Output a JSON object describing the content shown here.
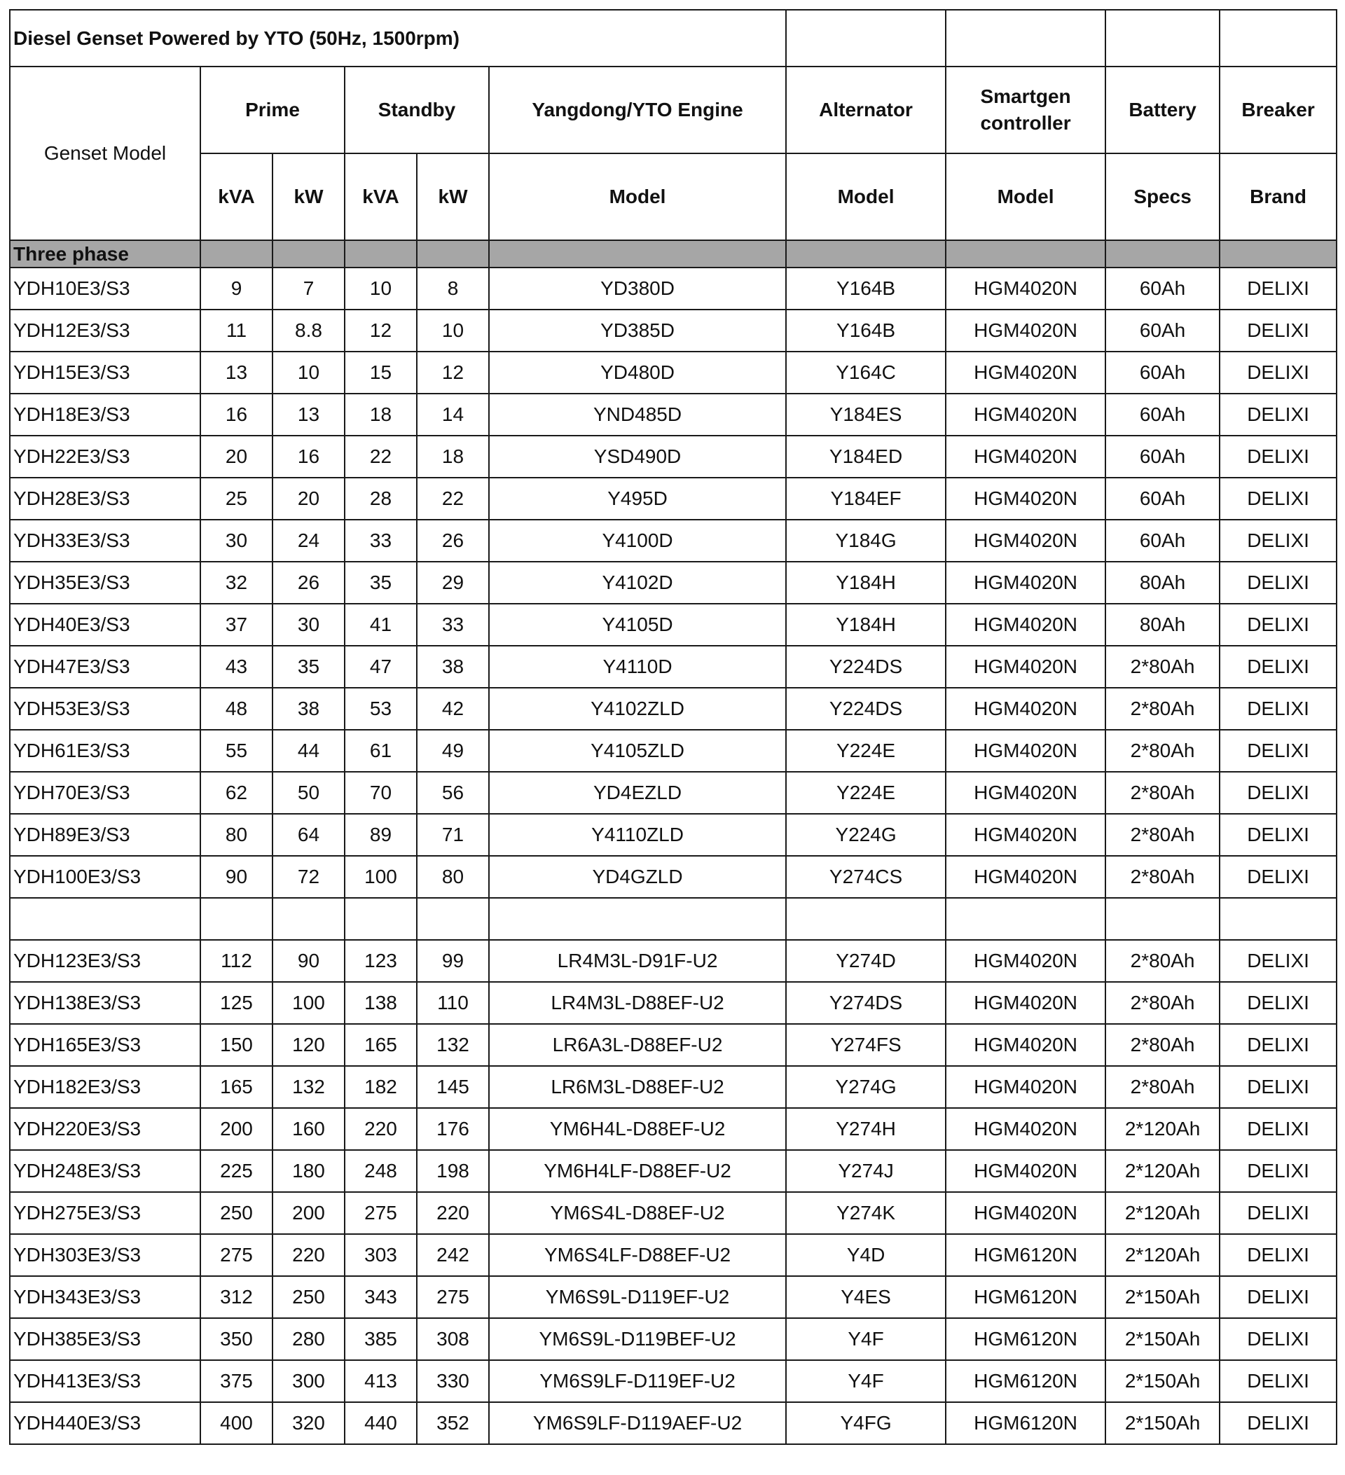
{
  "title": "Diesel Genset Powered by YTO (50Hz, 1500rpm)",
  "headers": {
    "genset_model": "Genset Model",
    "prime": "Prime",
    "standby": "Standby",
    "engine": "Yangdong/YTO Engine",
    "alternator": "Alternator",
    "controller": "Smartgen controller",
    "battery": "Battery",
    "breaker": "Breaker",
    "kva1": "kVA",
    "kw1": "kW",
    "kva2": "kVA",
    "kw2": "kW",
    "engine_sub": "Model",
    "alternator_sub": "Model",
    "controller_sub": "Model",
    "battery_sub": "Specs",
    "breaker_sub": "Brand"
  },
  "section_label": "Three phase",
  "rows_a": [
    [
      "YDH10E3/S3",
      "9",
      "7",
      "10",
      "8",
      "YD380D",
      "Y164B",
      "HGM4020N",
      "60Ah",
      "DELIXI"
    ],
    [
      "YDH12E3/S3",
      "11",
      "8.8",
      "12",
      "10",
      "YD385D",
      "Y164B",
      "HGM4020N",
      "60Ah",
      "DELIXI"
    ],
    [
      "YDH15E3/S3",
      "13",
      "10",
      "15",
      "12",
      "YD480D",
      "Y164C",
      "HGM4020N",
      "60Ah",
      "DELIXI"
    ],
    [
      "YDH18E3/S3",
      "16",
      "13",
      "18",
      "14",
      "YND485D",
      "Y184ES",
      "HGM4020N",
      "60Ah",
      "DELIXI"
    ],
    [
      "YDH22E3/S3",
      "20",
      "16",
      "22",
      "18",
      "YSD490D",
      "Y184ED",
      "HGM4020N",
      "60Ah",
      "DELIXI"
    ],
    [
      "YDH28E3/S3",
      "25",
      "20",
      "28",
      "22",
      "Y495D",
      "Y184EF",
      "HGM4020N",
      "60Ah",
      "DELIXI"
    ],
    [
      "YDH33E3/S3",
      "30",
      "24",
      "33",
      "26",
      "Y4100D",
      "Y184G",
      "HGM4020N",
      "60Ah",
      "DELIXI"
    ],
    [
      "YDH35E3/S3",
      "32",
      "26",
      "35",
      "29",
      "Y4102D",
      "Y184H",
      "HGM4020N",
      "80Ah",
      "DELIXI"
    ],
    [
      "YDH40E3/S3",
      "37",
      "30",
      "41",
      "33",
      "Y4105D",
      "Y184H",
      "HGM4020N",
      "80Ah",
      "DELIXI"
    ],
    [
      "YDH47E3/S3",
      "43",
      "35",
      "47",
      "38",
      "Y4110D",
      "Y224DS",
      "HGM4020N",
      "2*80Ah",
      "DELIXI"
    ],
    [
      "YDH53E3/S3",
      "48",
      "38",
      "53",
      "42",
      "Y4102ZLD",
      "Y224DS",
      "HGM4020N",
      "2*80Ah",
      "DELIXI"
    ],
    [
      "YDH61E3/S3",
      "55",
      "44",
      "61",
      "49",
      "Y4105ZLD",
      "Y224E",
      "HGM4020N",
      "2*80Ah",
      "DELIXI"
    ],
    [
      "YDH70E3/S3",
      "62",
      "50",
      "70",
      "56",
      "YD4EZLD",
      "Y224E",
      "HGM4020N",
      "2*80Ah",
      "DELIXI"
    ],
    [
      "YDH89E3/S3",
      "80",
      "64",
      "89",
      "71",
      "Y4110ZLD",
      "Y224G",
      "HGM4020N",
      "2*80Ah",
      "DELIXI"
    ],
    [
      "YDH100E3/S3",
      "90",
      "72",
      "100",
      "80",
      "YD4GZLD",
      "Y274CS",
      "HGM4020N",
      "2*80Ah",
      "DELIXI"
    ]
  ],
  "rows_b": [
    [
      "YDH123E3/S3",
      "112",
      "90",
      "123",
      "99",
      "LR4M3L-D91F-U2",
      "Y274D",
      "HGM4020N",
      "2*80Ah",
      "DELIXI"
    ],
    [
      "YDH138E3/S3",
      "125",
      "100",
      "138",
      "110",
      "LR4M3L-D88EF-U2",
      "Y274DS",
      "HGM4020N",
      "2*80Ah",
      "DELIXI"
    ],
    [
      "YDH165E3/S3",
      "150",
      "120",
      "165",
      "132",
      "LR6A3L-D88EF-U2",
      "Y274FS",
      "HGM4020N",
      "2*80Ah",
      "DELIXI"
    ],
    [
      "YDH182E3/S3",
      "165",
      "132",
      "182",
      "145",
      "LR6M3L-D88EF-U2",
      "Y274G",
      "HGM4020N",
      "2*80Ah",
      "DELIXI"
    ],
    [
      "YDH220E3/S3",
      "200",
      "160",
      "220",
      "176",
      "YM6H4L-D88EF-U2",
      "Y274H",
      "HGM4020N",
      "2*120Ah",
      "DELIXI"
    ],
    [
      "YDH248E3/S3",
      "225",
      "180",
      "248",
      "198",
      "YM6H4LF-D88EF-U2",
      "Y274J",
      "HGM4020N",
      "2*120Ah",
      "DELIXI"
    ],
    [
      "YDH275E3/S3",
      "250",
      "200",
      "275",
      "220",
      "YM6S4L-D88EF-U2",
      "Y274K",
      "HGM4020N",
      "2*120Ah",
      "DELIXI"
    ],
    [
      "YDH303E3/S3",
      "275",
      "220",
      "303",
      "242",
      "YM6S4LF-D88EF-U2",
      "Y4D",
      "HGM6120N",
      "2*120Ah",
      "DELIXI"
    ],
    [
      "YDH343E3/S3",
      "312",
      "250",
      "343",
      "275",
      "YM6S9L-D119EF-U2",
      "Y4ES",
      "HGM6120N",
      "2*150Ah",
      "DELIXI"
    ],
    [
      "YDH385E3/S3",
      "350",
      "280",
      "385",
      "308",
      "YM6S9L-D119BEF-U2",
      "Y4F",
      "HGM6120N",
      "2*150Ah",
      "DELIXI"
    ],
    [
      "YDH413E3/S3",
      "375",
      "300",
      "413",
      "330",
      "YM6S9LF-D119EF-U2",
      "Y4F",
      "HGM6120N",
      "2*150Ah",
      "DELIXI"
    ],
    [
      "YDH440E3/S3",
      "400",
      "320",
      "440",
      "352",
      "YM6S9LF-D119AEF-U2",
      "Y4FG",
      "HGM6120N",
      "2*150Ah",
      "DELIXI"
    ]
  ]
}
